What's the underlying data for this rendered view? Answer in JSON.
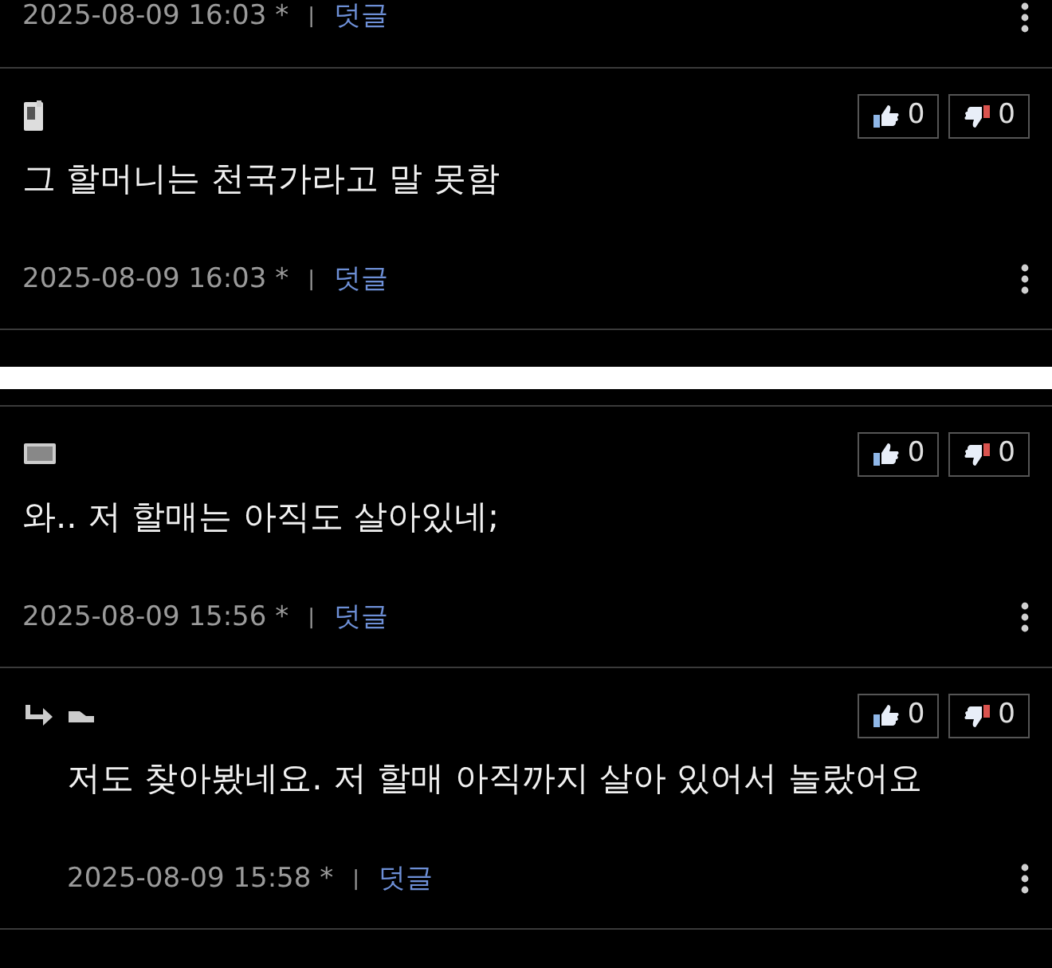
{
  "panels": [
    {
      "comments": [
        {
          "kind": "tail",
          "date": "2025-08-09 16:03 *",
          "separator": "|",
          "reply_link": "덧글"
        },
        {
          "kind": "comment",
          "reply": false,
          "avatar": {
            "kind": "phone"
          },
          "text": "그 할머니는 천국가라고 말 못함",
          "likes": "0",
          "dislikes": "0",
          "date": "2025-08-09 16:03 *",
          "separator": "|",
          "reply_link": "덧글"
        }
      ]
    },
    {
      "comments": [
        {
          "kind": "comment",
          "reply": false,
          "avatar": {
            "kind": "monitor"
          },
          "text": "와.. 저 할매는 아직도 살아있네;",
          "likes": "0",
          "dislikes": "0",
          "date": "2025-08-09 15:56 *",
          "separator": "|",
          "reply_link": "덧글"
        },
        {
          "kind": "comment",
          "reply": true,
          "avatar": {
            "kind": "shoe"
          },
          "text": "저도 찾아봤네요. 저 할매 아직까지 살아 있어서 놀랐어요",
          "likes": "0",
          "dislikes": "0",
          "date": "2025-08-09 15:58 *",
          "separator": "|",
          "reply_link": "덧글"
        }
      ]
    }
  ]
}
